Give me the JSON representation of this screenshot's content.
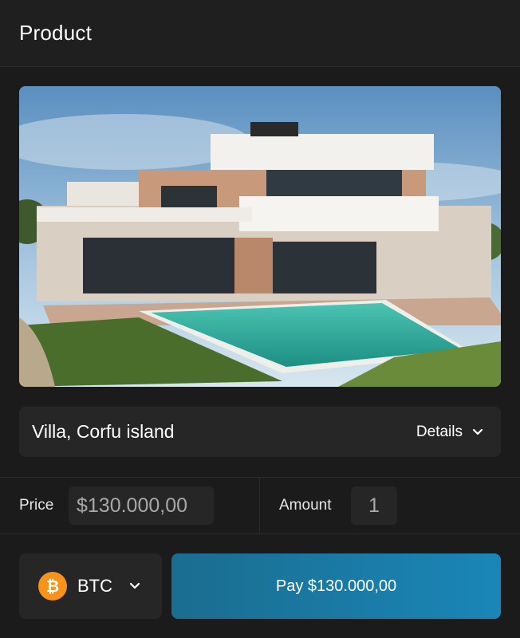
{
  "header": {
    "title": "Product"
  },
  "product": {
    "name": "Villa, Corfu island",
    "details_label": "Details"
  },
  "order": {
    "price_label": "Price",
    "price_value": "$130.000,00",
    "amount_label": "Amount",
    "amount_value": "1"
  },
  "payment": {
    "currency": "BTC",
    "currency_icon": "bitcoin-icon",
    "pay_label": "Pay $130.000,00"
  },
  "colors": {
    "background": "#1b1b1b",
    "panel": "#262626",
    "accent": "#1a86b8",
    "bitcoin": "#f7931a"
  }
}
